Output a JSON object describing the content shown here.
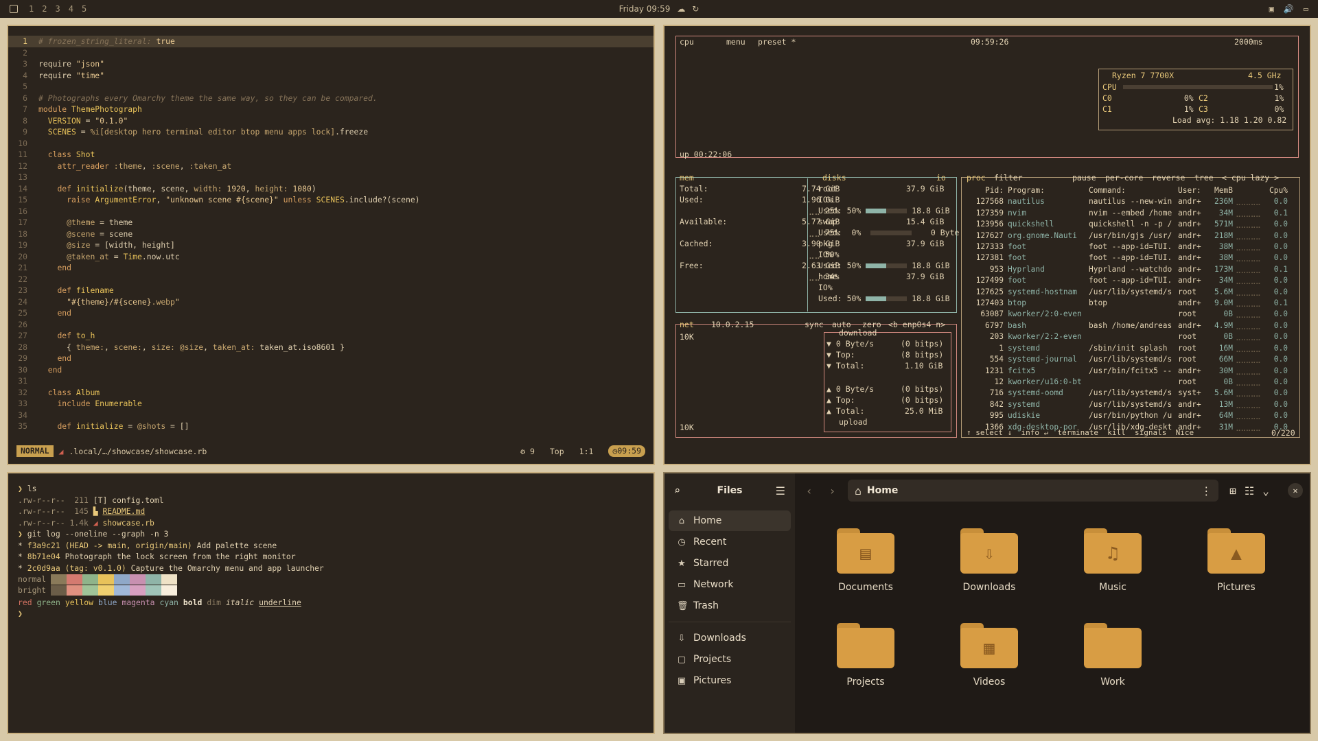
{
  "topbar": {
    "workspaces": [
      "1",
      "2",
      "3",
      "4",
      "5"
    ],
    "clock": "Friday 09:59",
    "icons": [
      "workspace-logo-icon",
      "cloud-icon",
      "refresh-icon",
      "screen-icon",
      "volume-icon",
      "battery-icon"
    ]
  },
  "editor": {
    "lines": [
      {
        "n": "1",
        "html": "<span class='cm'># frozen_string_literal:</span> <span class='str'>true</span>"
      },
      {
        "n": "2",
        "html": ""
      },
      {
        "n": "3",
        "html": "require <span class='str'>\"json\"</span>"
      },
      {
        "n": "4",
        "html": "require <span class='str'>\"time\"</span>"
      },
      {
        "n": "5",
        "html": ""
      },
      {
        "n": "6",
        "html": "<span class='cm'># Photographs every Omarchy theme the same way, so they can be compared.</span>"
      },
      {
        "n": "7",
        "html": "<span class='kw'>module</span> <span class='cls'>ThemePhotograph</span>"
      },
      {
        "n": "8",
        "html": "  <span class='cls'>VERSION</span> = <span class='str'>\"0.1.0\"</span>"
      },
      {
        "n": "9",
        "html": "  <span class='cls'>SCENES</span> = <span class='sym'>%i[desktop hero terminal editor btop menu apps lock]</span>.freeze"
      },
      {
        "n": "10",
        "html": ""
      },
      {
        "n": "11",
        "html": "  <span class='kw'>class</span> <span class='cls'>Shot</span>"
      },
      {
        "n": "12",
        "html": "    <span class='kw'>attr_reader</span> <span class='sym'>:theme</span>, <span class='sym'>:scene</span>, <span class='sym'>:taken_at</span>"
      },
      {
        "n": "13",
        "html": ""
      },
      {
        "n": "14",
        "html": "    <span class='kw'>def</span> <span class='cls'>initialize</span>(theme, scene, <span class='sym'>width:</span> <span class='str'>1920</span>, <span class='sym'>height:</span> <span class='str'>1080</span>)"
      },
      {
        "n": "15",
        "html": "      <span class='kw'>raise</span> <span class='cls'>ArgumentError</span>, <span class='str'>\"unknown scene #{scene}\"</span> <span class='kw'>unless</span> <span class='cls'>SCENES</span>.include?(scene)"
      },
      {
        "n": "16",
        "html": ""
      },
      {
        "n": "17",
        "html": "      <span class='sym'>@theme</span> = theme"
      },
      {
        "n": "18",
        "html": "      <span class='sym'>@scene</span> = scene"
      },
      {
        "n": "19",
        "html": "      <span class='sym'>@size</span> = [width, height]"
      },
      {
        "n": "20",
        "html": "      <span class='sym'>@taken_at</span> = <span class='cls'>Time</span>.now.utc"
      },
      {
        "n": "21",
        "html": "    <span class='kw'>end</span>"
      },
      {
        "n": "22",
        "html": ""
      },
      {
        "n": "23",
        "html": "    <span class='kw'>def</span> <span class='cls'>filename</span>"
      },
      {
        "n": "24",
        "html": "      <span class='str'>\"#{theme}/#{scene}</span><span class='sym'>.webp</span><span class='str'>\"</span>"
      },
      {
        "n": "25",
        "html": "    <span class='kw'>end</span>"
      },
      {
        "n": "26",
        "html": ""
      },
      {
        "n": "27",
        "html": "    <span class='kw'>def</span> <span class='cls'>to_h</span>"
      },
      {
        "n": "28",
        "html": "      { <span class='sym'>theme:</span>, <span class='sym'>scene:</span>, <span class='sym'>size:</span> <span class='sym'>@size</span>, <span class='sym'>taken_at:</span> taken_at.iso8601 }"
      },
      {
        "n": "29",
        "html": "    <span class='kw'>end</span>"
      },
      {
        "n": "30",
        "html": "  <span class='kw'>end</span>"
      },
      {
        "n": "31",
        "html": ""
      },
      {
        "n": "32",
        "html": "  <span class='kw'>class</span> <span class='cls'>Album</span>"
      },
      {
        "n": "33",
        "html": "    <span class='kw'>include</span> <span class='cls'>Enumerable</span>"
      },
      {
        "n": "34",
        "html": ""
      },
      {
        "n": "35",
        "html": "    <span class='kw'>def</span> <span class='cls'>initialize</span> = <span class='sym'>@shots</span> = []"
      }
    ],
    "status": {
      "mode": "NORMAL",
      "file": ".local/…/showcase/showcase.rb",
      "lsp": "9",
      "position": "Top",
      "cursor": "1:1",
      "time": "09:59"
    }
  },
  "btop": {
    "cpu_title": "cpu",
    "menu": "menu",
    "preset": "preset *",
    "time": "09:59:26",
    "interval": "2000ms",
    "cpu_model": "Ryzen 7 7700X",
    "freq": "4.5 GHz",
    "cpu_label": "CPU",
    "cpu_pct": "1%",
    "cores": [
      {
        "n": "C0",
        "v": "0%"
      },
      {
        "n": "C1",
        "v": "1%"
      },
      {
        "n": "C2",
        "v": "1%"
      },
      {
        "n": "C3",
        "v": "0%"
      }
    ],
    "load": "Load avg: 1.18 1.20 0.82",
    "uptime": "up 00:22:06",
    "mem": {
      "title": "mem",
      "total_l": "Total:",
      "total": "7.74 GiB",
      "used_l": "Used:",
      "used": "1.96 GiB",
      "used_p": "25%",
      "avail_l": "Available:",
      "avail": "5.77 GiB",
      "avail_p": "75%",
      "cached_l": "Cached:",
      "cached": "3.90 GiB",
      "cached_p": "50%",
      "free_l": "Free:",
      "free": "2.63 GiB",
      "free_p": "34%"
    },
    "disks": {
      "title": "disks",
      "io": "io",
      "root": "root",
      "root_v": "37.9 GiB",
      "io_l": "IO%",
      "used_l": "Used:",
      "pct": "50%",
      "used_v": "18.8 GiB",
      "swap": "swap",
      "swap_v": "15.4 GiB",
      "swap_used": "0%",
      "swap_used_v": "0 Byte",
      "pkg": "pkg",
      "pkg_v": "37.9 GiB",
      "home": "home",
      "home_v": "37.9 GiB"
    },
    "net": {
      "title": "net",
      "ip": "10.0.2.15",
      "sync": "sync",
      "auto": "auto",
      "zero": "zero",
      "iface": "<b enp0s4 n>",
      "scale": "10K",
      "download": "download",
      "upload": "upload",
      "down_rate": "▼ 0 Byte/s",
      "down_bits": "(0 bitps)",
      "down_top": "▼ Top:",
      "down_top_b": "(8 bitps)",
      "down_total": "▼ Total:",
      "down_total_v": "1.10 GiB",
      "up_rate": "▲ 0 Byte/s",
      "up_bits": "(0 bitps)",
      "up_top": "▲ Top:",
      "up_top_b": "(0 bitps)",
      "up_total": "▲ Total:",
      "up_total_v": "25.0 MiB"
    },
    "proc": {
      "title": "proc",
      "filter": "filter",
      "pause": "pause",
      "percore": "per-core",
      "reverse": "reverse",
      "tree": "tree",
      "sort": "< cpu lazy >",
      "count": "0/220",
      "footer": "↑ select ↓  info ↵  terminate  kill  signals  Nice",
      "headers": {
        "pid": "Pid:",
        "prog": "Program:",
        "cmd": "Command:",
        "user": "User:",
        "mem": "MemB",
        "cpu": "Cpu%"
      },
      "rows": [
        {
          "pid": "127568",
          "prog": "nautilus",
          "cmd": "nautilus --new-win",
          "user": "andr+",
          "mem": "236M",
          "cpu": "0.0"
        },
        {
          "pid": "127359",
          "prog": "nvim",
          "cmd": "nvim --embed /home",
          "user": "andr+",
          "mem": "34M",
          "cpu": "0.1"
        },
        {
          "pid": "123956",
          "prog": "quickshell",
          "cmd": "quickshell -n -p /",
          "user": "andr+",
          "mem": "571M",
          "cpu": "0.0"
        },
        {
          "pid": "127627",
          "prog": "org.gnome.Nauti",
          "cmd": "/usr/bin/gjs /usr/",
          "user": "andr+",
          "mem": "218M",
          "cpu": "0.0"
        },
        {
          "pid": "127333",
          "prog": "foot",
          "cmd": "foot --app-id=TUI.",
          "user": "andr+",
          "mem": "38M",
          "cpu": "0.0"
        },
        {
          "pid": "127381",
          "prog": "foot",
          "cmd": "foot --app-id=TUI.",
          "user": "andr+",
          "mem": "38M",
          "cpu": "0.0"
        },
        {
          "pid": "953",
          "prog": "Hyprland",
          "cmd": "Hyprland --watchdo",
          "user": "andr+",
          "mem": "173M",
          "cpu": "0.1"
        },
        {
          "pid": "127499",
          "prog": "foot",
          "cmd": "foot --app-id=TUI.",
          "user": "andr+",
          "mem": "34M",
          "cpu": "0.0"
        },
        {
          "pid": "127625",
          "prog": "systemd-hostnam",
          "cmd": "/usr/lib/systemd/s",
          "user": "root",
          "mem": "5.6M",
          "cpu": "0.0"
        },
        {
          "pid": "127403",
          "prog": "btop",
          "cmd": "btop",
          "user": "andr+",
          "mem": "9.0M",
          "cpu": "0.1"
        },
        {
          "pid": "63087",
          "prog": "kworker/2:0-even",
          "cmd": "",
          "user": "root",
          "mem": "0B",
          "cpu": "0.0"
        },
        {
          "pid": "6797",
          "prog": "bash",
          "cmd": "bash /home/andreas",
          "user": "andr+",
          "mem": "4.9M",
          "cpu": "0.0"
        },
        {
          "pid": "203",
          "prog": "kworker/2:2-even",
          "cmd": "",
          "user": "root",
          "mem": "0B",
          "cpu": "0.0"
        },
        {
          "pid": "1",
          "prog": "systemd",
          "cmd": "/sbin/init splash",
          "user": "root",
          "mem": "16M",
          "cpu": "0.0"
        },
        {
          "pid": "554",
          "prog": "systemd-journal",
          "cmd": "/usr/lib/systemd/s",
          "user": "root",
          "mem": "66M",
          "cpu": "0.0"
        },
        {
          "pid": "1231",
          "prog": "fcitx5",
          "cmd": "/usr/bin/fcitx5 --",
          "user": "andr+",
          "mem": "30M",
          "cpu": "0.0"
        },
        {
          "pid": "12",
          "prog": "kworker/u16:0-bt",
          "cmd": "",
          "user": "root",
          "mem": "0B",
          "cpu": "0.0"
        },
        {
          "pid": "716",
          "prog": "systemd-oomd",
          "cmd": "/usr/lib/systemd/s",
          "user": "syst+",
          "mem": "5.6M",
          "cpu": "0.0"
        },
        {
          "pid": "842",
          "prog": "systemd",
          "cmd": "/usr/lib/systemd/s",
          "user": "andr+",
          "mem": "13M",
          "cpu": "0.0"
        },
        {
          "pid": "995",
          "prog": "udiskie",
          "cmd": "/usr/bin/python /u",
          "user": "andr+",
          "mem": "64M",
          "cpu": "0.0"
        },
        {
          "pid": "1366",
          "prog": "xdg-desktop-por",
          "cmd": "/usr/lib/xdg-deskt",
          "user": "andr+",
          "mem": "31M",
          "cpu": "0.0"
        }
      ]
    }
  },
  "terminal": {
    "lines": [
      "<span style='color:#e8c87a'>❯</span> ls",
      "<span style='color:#a8987a'>.rw-r--r--</span>  <span style='color:#9b8b70'>211</span> <span style='color:#e0d0b0'>[T] config.toml</span>",
      "<span style='color:#a8987a'>.rw-r--r--</span>  <span style='color:#9b8b70'>145</span> <span style='color:#e8c87a'>▙ <u>README.md</u></span>",
      "<span style='color:#a8987a'>.rw-r--r--</span> <span style='color:#9b8b70'>1.4k</span> <span style='color:#d06050'>◢</span> <span style='color:#e8c87a'>showcase.rb</span>",
      "<span style='color:#e8c87a'>❯</span> git log --oneline --graph -n 3",
      "* <span style='color:#e8c87a'>f3a9c21</span> <span style='color:#e8c87a'>(HEAD -&gt; main, origin/main)</span> Add palette scene",
      "* <span style='color:#e8c87a'>8b71e04</span> Photograph the lock screen from the right monitor",
      "* <span style='color:#e8c87a'>2c0d9aa</span> <span style='color:#e8c87a'>(tag: v0.1.0)</span> Capture the Omarchy menu and app launcher"
    ],
    "normal_label": "normal",
    "bright_label": "bright",
    "words": [
      {
        "t": "red",
        "c": "#d07060"
      },
      {
        "t": "green",
        "c": "#8fb48a"
      },
      {
        "t": "yellow",
        "c": "#e8c25a"
      },
      {
        "t": "blue",
        "c": "#8fa8c8"
      },
      {
        "t": "magenta",
        "c": "#c890b0"
      },
      {
        "t": "cyan",
        "c": "#8fb4a8"
      },
      {
        "t": "bold",
        "c": "#f0e4cc"
      },
      {
        "t": "dim",
        "c": "#8a7a60"
      },
      {
        "t": "italic",
        "c": "#e0d0b0"
      },
      {
        "t": "underline",
        "c": "#e0d0b0"
      }
    ],
    "prompt": "❯",
    "palette_normal": [
      "#8a7a5a",
      "#d47a70",
      "#8fb48a",
      "#e8c25a",
      "#8fa8c8",
      "#c890b0",
      "#8fb4a8",
      "#efe2c6"
    ],
    "palette_bright": [
      "#6b5d48",
      "#e09080",
      "#a0c498",
      "#f0d070",
      "#a0b8d8",
      "#d8a0c0",
      "#a0c4b8",
      "#f8eedc"
    ]
  },
  "files": {
    "title": "Files",
    "path": "Home",
    "sidebar": [
      {
        "label": "Home",
        "icon": "⌂",
        "name": "home-icon",
        "sel": true
      },
      {
        "label": "Recent",
        "icon": "◷",
        "name": "recent-icon"
      },
      {
        "label": "Starred",
        "icon": "★",
        "name": "star-icon"
      },
      {
        "label": "Network",
        "icon": "▭",
        "name": "network-icon"
      },
      {
        "label": "Trash",
        "icon": "🗑",
        "name": "trash-icon"
      }
    ],
    "bookmarks": [
      {
        "label": "Downloads",
        "icon": "⇩",
        "name": "download-icon"
      },
      {
        "label": "Projects",
        "icon": "▢",
        "name": "folder-icon"
      },
      {
        "label": "Pictures",
        "icon": "▣",
        "name": "image-icon"
      }
    ],
    "folders": [
      {
        "label": "Documents",
        "glyph": "▤",
        "name": "documents-folder"
      },
      {
        "label": "Downloads",
        "glyph": "⇩",
        "name": "downloads-folder"
      },
      {
        "label": "Music",
        "glyph": "♫",
        "name": "music-folder"
      },
      {
        "label": "Pictures",
        "glyph": "▲",
        "name": "pictures-folder"
      },
      {
        "label": "Projects",
        "glyph": "",
        "name": "projects-folder"
      },
      {
        "label": "Videos",
        "glyph": "▦",
        "name": "videos-folder"
      },
      {
        "label": "Work",
        "glyph": "",
        "name": "work-folder"
      }
    ]
  }
}
